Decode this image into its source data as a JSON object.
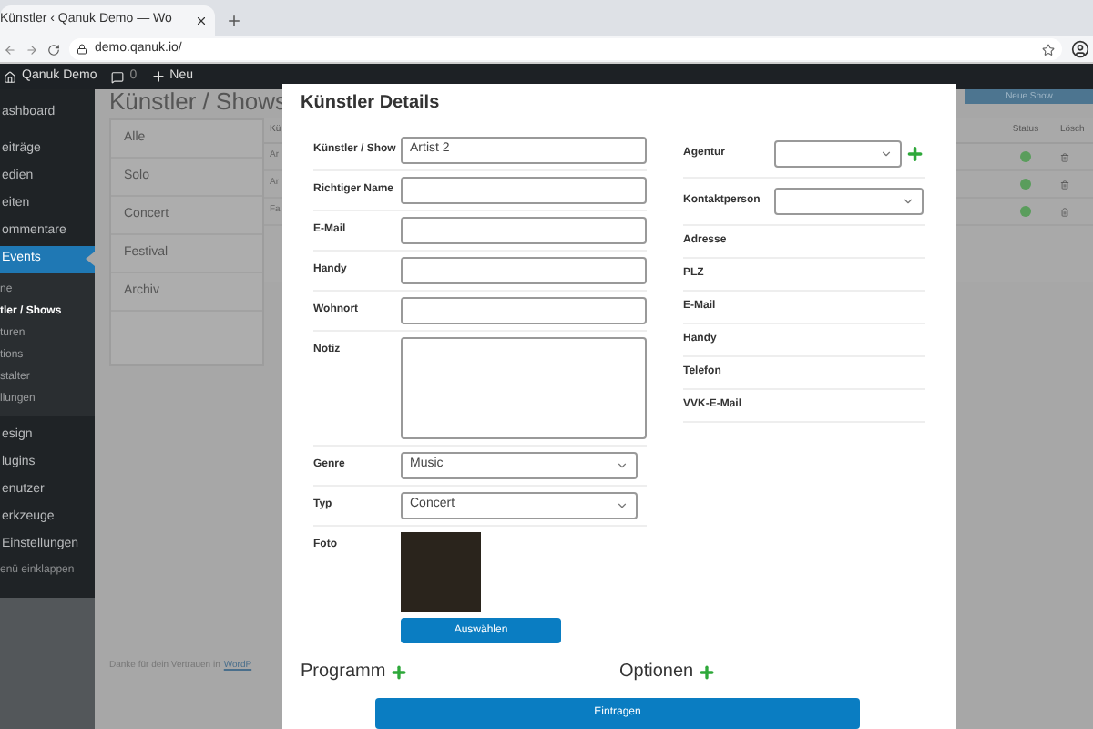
{
  "browser": {
    "tab_title": "Künstler ‹ Qanuk Demo — Wo",
    "url": "demo.qanuk.io/"
  },
  "admin_bar": {
    "site": "Qanuk Demo",
    "comments": "0",
    "new": "Neu"
  },
  "sidebar": {
    "items": [
      {
        "label": "ashboard",
        "selected": false
      },
      {
        "label": "eiträge",
        "selected": false
      },
      {
        "label": "edien",
        "selected": false
      },
      {
        "label": "eiten",
        "selected": false
      },
      {
        "label": "ommentare",
        "selected": false
      },
      {
        "label": "Events",
        "selected": true,
        "children": [
          {
            "label": "ne",
            "selected": false
          },
          {
            "label": "tler / Shows",
            "selected": true
          },
          {
            "label": "turen",
            "selected": false
          },
          {
            "label": "tions",
            "selected": false
          },
          {
            "label": "stalter",
            "selected": false
          },
          {
            "label": "llungen",
            "selected": false
          }
        ]
      },
      {
        "label": "esign",
        "selected": false
      },
      {
        "label": "lugins",
        "selected": false
      },
      {
        "label": "enutzer",
        "selected": false
      },
      {
        "label": "erkzeuge",
        "selected": false
      },
      {
        "label": "Einstellungen",
        "selected": false
      }
    ],
    "collapse": "enü einklappen"
  },
  "page": {
    "heading": "Künstler / Shows",
    "new_button": "Neue Show",
    "filters": [
      "Alle",
      "Solo",
      "Concert",
      "Festival",
      "Archiv"
    ],
    "table": {
      "columns": [
        "Kü",
        "Status",
        "Lösch"
      ],
      "rows": [
        {
          "name": "Ar",
          "active": true
        },
        {
          "name": "Ar",
          "active": true
        },
        {
          "name": "Fa",
          "active": true
        }
      ]
    },
    "footer": {
      "text": "Danke für dein Vertrauen in",
      "link": "WordP"
    }
  },
  "modal": {
    "title": "Künstler Details",
    "left_fields": [
      {
        "kind": "text",
        "label": "Künstler / Show",
        "value": "Artist 2"
      },
      {
        "kind": "text",
        "label": "Richtiger Name"
      },
      {
        "kind": "text",
        "label": "E-Mail"
      },
      {
        "kind": "text",
        "label": "Handy"
      },
      {
        "kind": "text",
        "label": "Wohnort"
      },
      {
        "kind": "textarea",
        "label": "Notiz"
      },
      {
        "kind": "select",
        "label": "Genre",
        "value": "Music"
      },
      {
        "kind": "select",
        "label": "Typ",
        "value": "Concert"
      },
      {
        "kind": "photo",
        "label": "Foto",
        "button": "Auswählen"
      }
    ],
    "right_fields": [
      {
        "kind": "select",
        "label": "Agentur",
        "addable": true
      },
      {
        "kind": "select",
        "label": "Kontaktperson",
        "addable": false
      },
      {
        "kind": "info",
        "label": "Adresse"
      },
      {
        "kind": "info",
        "label": "PLZ"
      },
      {
        "kind": "info",
        "label": "E-Mail"
      },
      {
        "kind": "info",
        "label": "Handy"
      },
      {
        "kind": "info",
        "label": "Telefon"
      },
      {
        "kind": "info",
        "label": "VVK-E-Mail"
      }
    ],
    "sections": [
      {
        "title": "Programm"
      },
      {
        "title": "Optionen"
      }
    ],
    "submit": "Eintragen"
  }
}
